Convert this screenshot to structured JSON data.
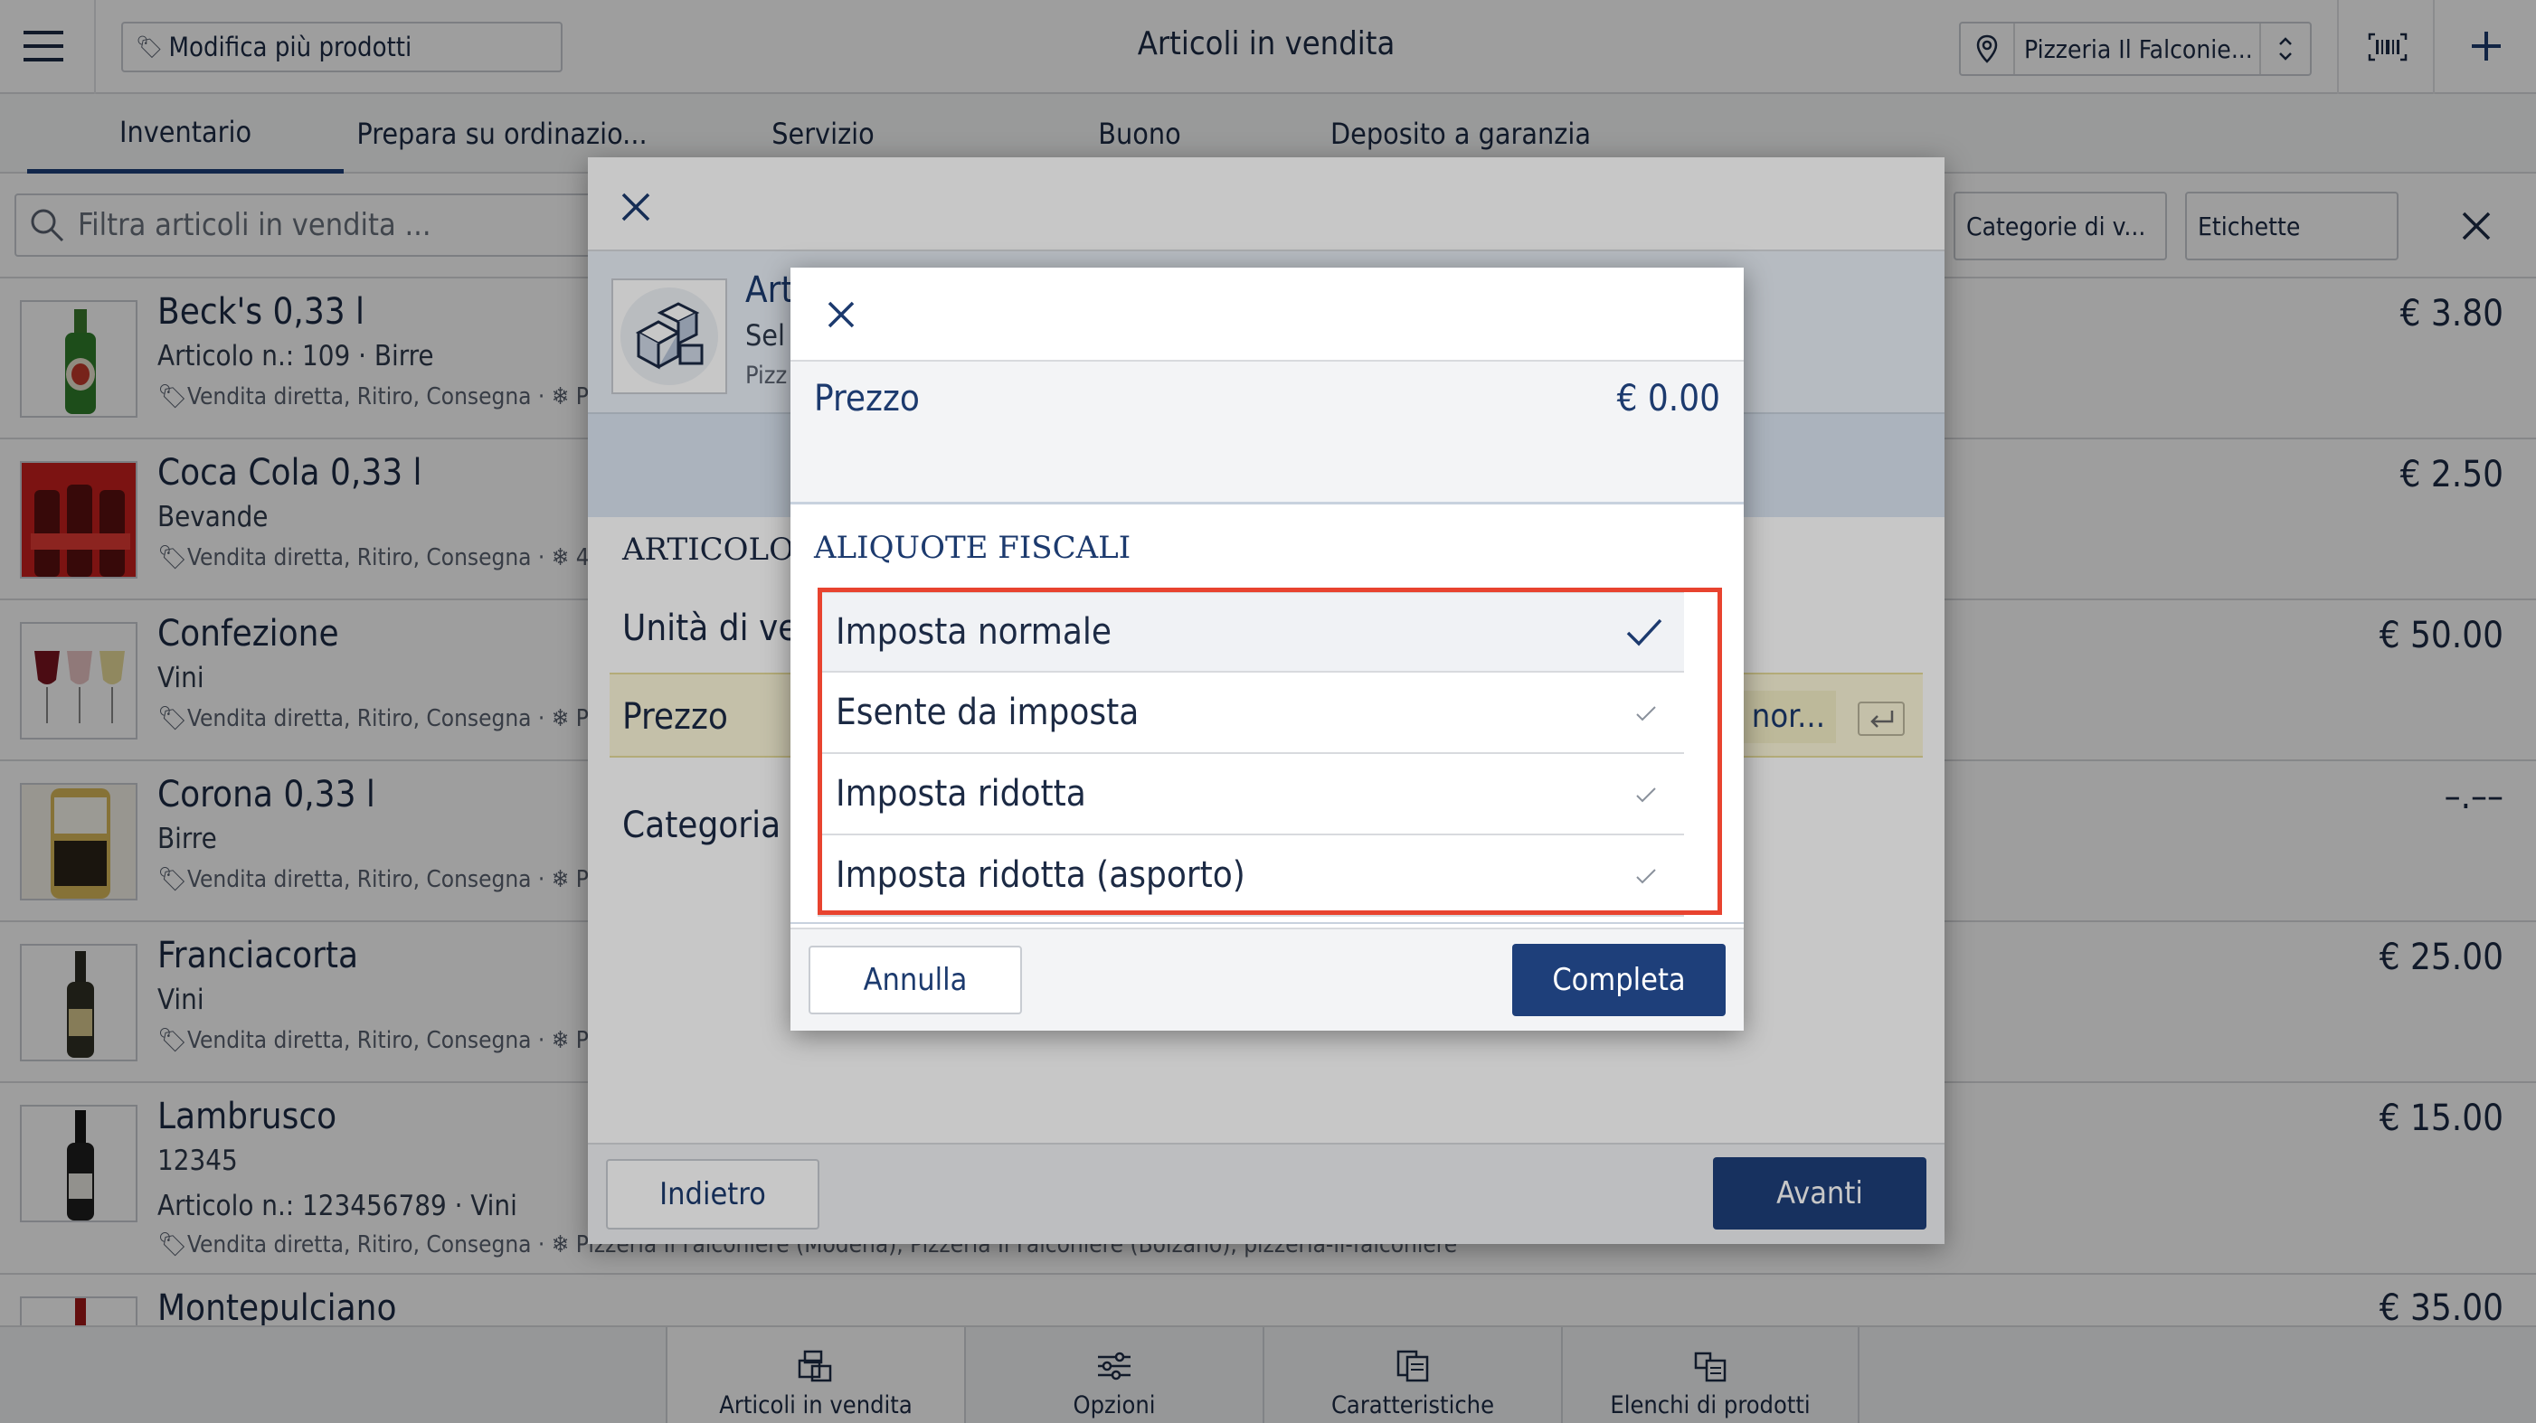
{
  "header": {
    "menu_icon": "menu-icon",
    "bulk_edit_label": "Modifica più prodotti",
    "title": "Articoli in vendita",
    "location": "Pizzeria Il Falconie...",
    "barcode_icon": "barcode-icon",
    "add_icon": "plus-icon"
  },
  "tabs": [
    {
      "label": "Inventario",
      "active": true
    },
    {
      "label": "Prepara su ordinazio..."
    },
    {
      "label": "Servizio"
    },
    {
      "label": "Buono"
    },
    {
      "label": "Deposito a garanzia"
    }
  ],
  "filter": {
    "placeholder": "Filtra articoli in vendita  ...",
    "categories_label": "Categorie di v...",
    "labels_label": "Etichette"
  },
  "items": [
    {
      "name": "Beck's 0,33 l",
      "sub": "Articolo n.: 109 · Birre",
      "channels": "Vendita diretta, Ritiro, Consegna · ❄ P",
      "price": "€ 3.80"
    },
    {
      "name": "Coca Cola 0,33 l",
      "sub": "Bevande",
      "channels": "Vendita diretta, Ritiro, Consegna · ❄ 4",
      "price": "€ 2.50"
    },
    {
      "name": "Confezione",
      "sub": "Vini",
      "channels": "Vendita diretta, Ritiro, Consegna · ❄ P",
      "price": "€ 50.00"
    },
    {
      "name": "Corona 0,33 l",
      "sub": "Birre",
      "channels": "Vendita diretta, Ritiro, Consegna · ❄ P",
      "price": "–.––"
    },
    {
      "name": "Franciacorta",
      "sub": "Vini",
      "channels": "Vendita diretta, Ritiro, Consegna · ❄ P",
      "price": "€ 25.00"
    },
    {
      "name": "Lambrusco",
      "sub": "12345",
      "sub2": "Articolo n.: 123456789 · Vini",
      "channels": "Vendita diretta, Ritiro, Consegna · ❄ Pizzeria Il Falconiere (Modena), Pizzeria Il Falconiere (Bolzano), pizzeria-il-falconiere",
      "price": "€ 15.00"
    },
    {
      "name": "Montepulciano",
      "price": "€ 35.00"
    }
  ],
  "bottom_tabs": [
    {
      "label": "Articoli in vendita",
      "icon": "boxes-icon"
    },
    {
      "label": "Opzioni",
      "icon": "sliders-icon"
    },
    {
      "label": "Caratteristiche",
      "icon": "features-icon"
    },
    {
      "label": "Elenchi di prodotti",
      "icon": "product-lists-icon"
    }
  ],
  "dialog1": {
    "title_partial": "Art",
    "sub1_partial": "Sel",
    "sub2_partial": "Pizz",
    "section_partial": "ARTICOLO D",
    "unit_partial": "Unità di ve",
    "price_label": "Prezzo",
    "price_value_partial": "nor...",
    "category_partial": "Categoria c",
    "back_label": "Indietro",
    "next_label": "Avanti"
  },
  "dialog2": {
    "price_label": "Prezzo",
    "price_value": "€ 0.00",
    "section_title": "ALIQUOTE FISCALI",
    "options": [
      {
        "label": "Imposta normale",
        "selected": true
      },
      {
        "label": "Esente da imposta",
        "selected": false
      },
      {
        "label": "Imposta ridotta",
        "selected": false
      },
      {
        "label": "Imposta ridotta (asporto)",
        "selected": false
      }
    ],
    "cancel_label": "Annulla",
    "confirm_label": "Completa"
  },
  "colors": {
    "accent": "#1e3f7a",
    "highlight": "#e8432f",
    "yellow_row": "#fbf7d9"
  }
}
